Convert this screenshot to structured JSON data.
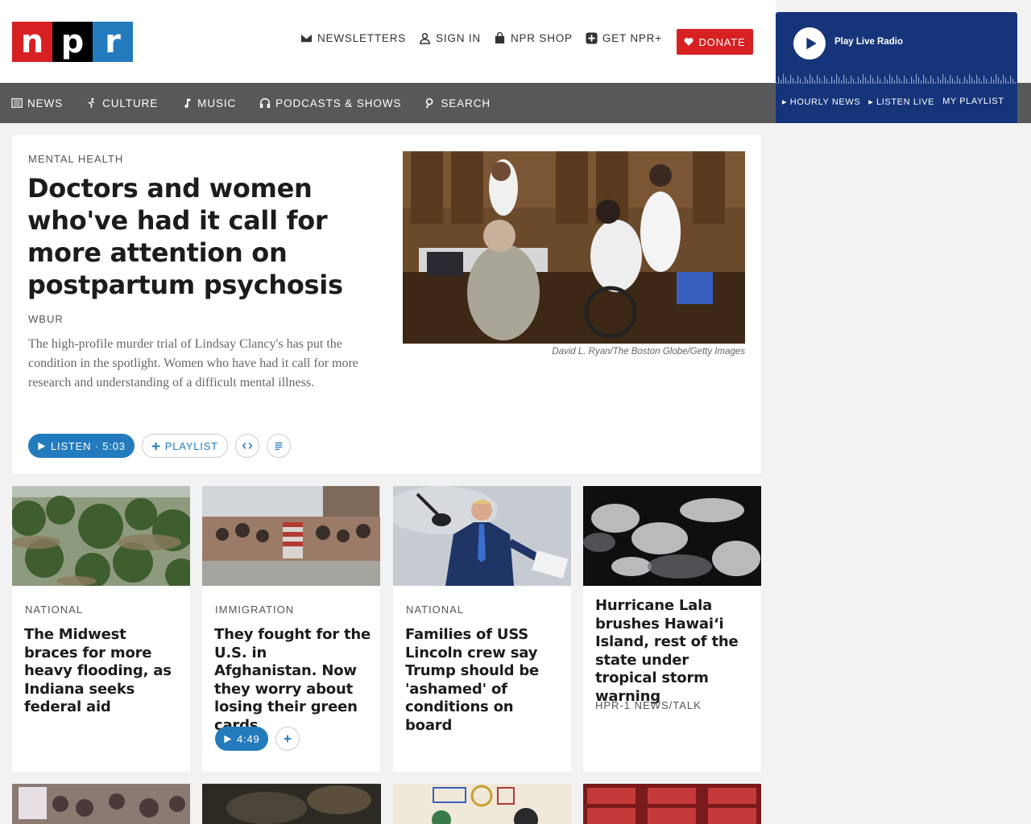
{
  "header": {
    "logo_letters": [
      "n",
      "p",
      "r"
    ],
    "util_links": [
      {
        "label": "NEWSLETTERS",
        "icon": "envelope-icon"
      },
      {
        "label": "SIGN IN",
        "icon": "user-icon"
      },
      {
        "label": "NPR SHOP",
        "icon": "shopping-bag-icon"
      },
      {
        "label": "GET NPR+",
        "icon": "plus-square-icon"
      }
    ],
    "donate_label": "DONATE"
  },
  "main_nav": [
    {
      "label": "NEWS",
      "icon": "news-icon"
    },
    {
      "label": "CULTURE",
      "icon": "culture-icon"
    },
    {
      "label": "MUSIC",
      "icon": "music-note-icon"
    },
    {
      "label": "PODCASTS & SHOWS",
      "icon": "headphones-icon"
    },
    {
      "label": "SEARCH",
      "icon": "search-icon"
    }
  ],
  "player": {
    "label": "Play Live Radio",
    "links": [
      "HOURLY NEWS",
      "LISTEN LIVE",
      "MY PLAYLIST"
    ]
  },
  "featured": {
    "slug": "MENTAL HEALTH",
    "title": "Doctors and women who've had it call for more attention on postpartum psychosis",
    "org": "WBUR",
    "teaser": "The high-profile murder trial of Lindsay Clancy's has put the condition in the spotlight. Women who have had it call for more research and understanding of a difficult mental illness.",
    "credit": "David L. Ryan/The Boston Globe/Getty Images",
    "listen_label": "LISTEN · 5:03",
    "playlist_label": "PLAYLIST"
  },
  "cards": [
    {
      "slug": "NATIONAL",
      "title": "The Midwest braces for more heavy flooding, as Indiana seeks federal aid"
    },
    {
      "slug": "IMMIGRATION",
      "title": "They fought for the U.S. in Afghanistan. Now they worry about losing their green cards",
      "listen_label": "4:49"
    },
    {
      "slug": "NATIONAL",
      "title": "Families of USS Lincoln crew say Trump should be 'ashamed' of conditions on board"
    },
    {
      "title": "Hurricane Lala brushes Hawai‘i Island, rest of the state under tropical storm warning",
      "org": "HPR-1 NEWS/TALK"
    }
  ],
  "colors": {
    "npr_red": "#d62021",
    "npr_blue": "#237bbd",
    "nav_gray": "#58585a",
    "player_navy": "#15347a"
  }
}
